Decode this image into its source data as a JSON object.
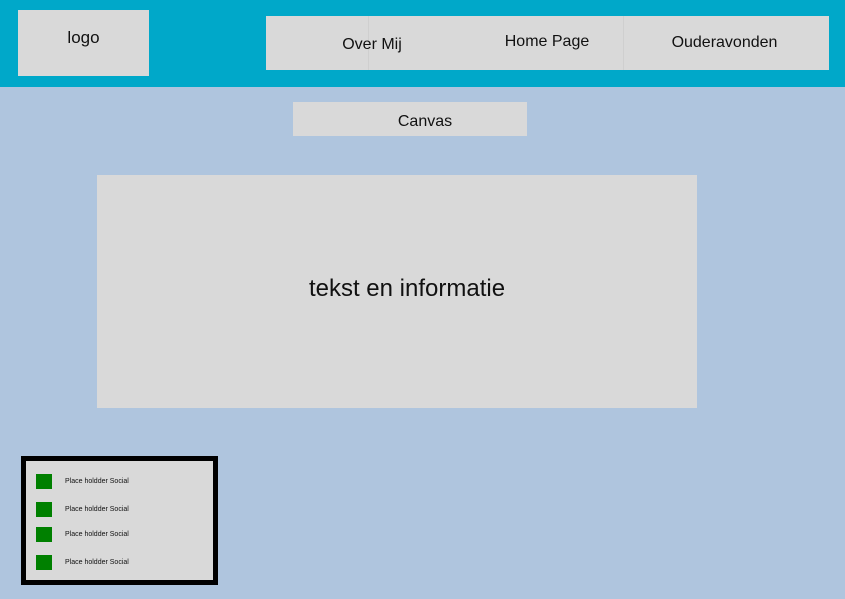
{
  "header": {
    "logo_text": "logo",
    "nav": [
      {
        "label": "Over Mij"
      },
      {
        "label": "Home Page"
      },
      {
        "label": "Ouderavonden"
      }
    ]
  },
  "main": {
    "canvas_label": "Canvas",
    "info_text": "tekst en informatie"
  },
  "social": {
    "items": [
      {
        "label": "Place holdder Social",
        "icon": "social-placeholder-icon"
      },
      {
        "label": "Place holdder Social",
        "icon": "social-placeholder-icon"
      },
      {
        "label": "Place holdder Social",
        "icon": "social-placeholder-icon"
      },
      {
        "label": "Place holdder Social",
        "icon": "social-placeholder-icon"
      }
    ]
  },
  "colors": {
    "page_background": "#afc5de",
    "header_background": "#00a8c9",
    "box_background": "#d9d9d9",
    "social_icon": "#008000",
    "social_border": "#000000"
  }
}
